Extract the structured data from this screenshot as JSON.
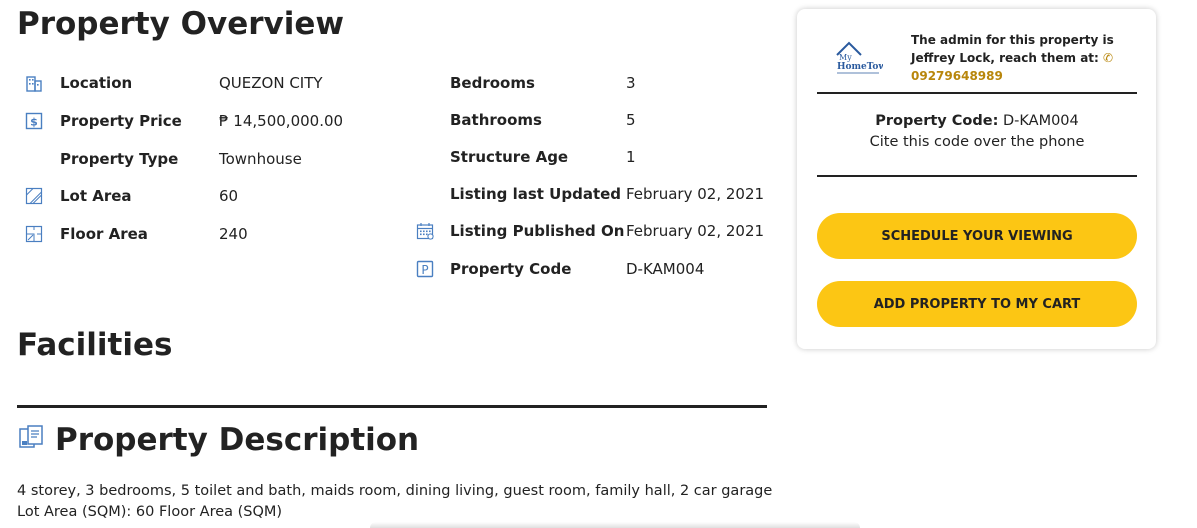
{
  "overview": {
    "title": "Property Overview",
    "left_rows": [
      {
        "icon": "building-icon",
        "label": "Location",
        "value": "QUEZON CITY"
      },
      {
        "icon": "price-tag-icon",
        "label": "Property Price",
        "value": "₱ 14,500,000.00"
      },
      {
        "icon": "",
        "label": "Property Type",
        "value": "Townhouse"
      },
      {
        "icon": "lot-map-icon",
        "label": "Lot Area",
        "value": "60"
      },
      {
        "icon": "floor-plan-icon",
        "label": "Floor Area",
        "value": "240"
      }
    ],
    "right_rows": [
      {
        "icon": "",
        "label": "Bedrooms",
        "value": "3"
      },
      {
        "icon": "",
        "label": "Bathrooms",
        "value": "5"
      },
      {
        "icon": "",
        "label": "Structure Age",
        "value": "1"
      },
      {
        "icon": "",
        "label": "Listing last Updated",
        "value": "February 02, 2021"
      },
      {
        "icon": "calendar-icon",
        "label": "Listing Published On",
        "value": "February 02, 2021"
      },
      {
        "icon": "parking-icon",
        "label": "Property Code",
        "value": "D-KAM004"
      }
    ]
  },
  "facilities": {
    "title": "Facilities"
  },
  "description": {
    "title": "Property Description",
    "text": "4 storey, 3 bedrooms, 5 toilet and bath, maids room, dining living, guest room, family hall, 2 car garage Lot Area (SQM): 60 Floor Area (SQM)"
  },
  "contact_card": {
    "logo_text_line1": "My",
    "logo_text_line2": "HomeTown",
    "admin_text": "The admin for this property is Jeffrey Lock, reach them at:",
    "phone": "09279648989",
    "code_label": "Property Code:",
    "code_value": "D-KAM004",
    "code_hint": "Cite this code over the phone",
    "schedule_button": "SCHEDULE YOUR VIEWING",
    "cart_button": "ADD PROPERTY TO MY CART"
  },
  "colors": {
    "accent": "#fcc614",
    "phone": "#b8860b",
    "icon_blue": "#4a7fc1"
  }
}
